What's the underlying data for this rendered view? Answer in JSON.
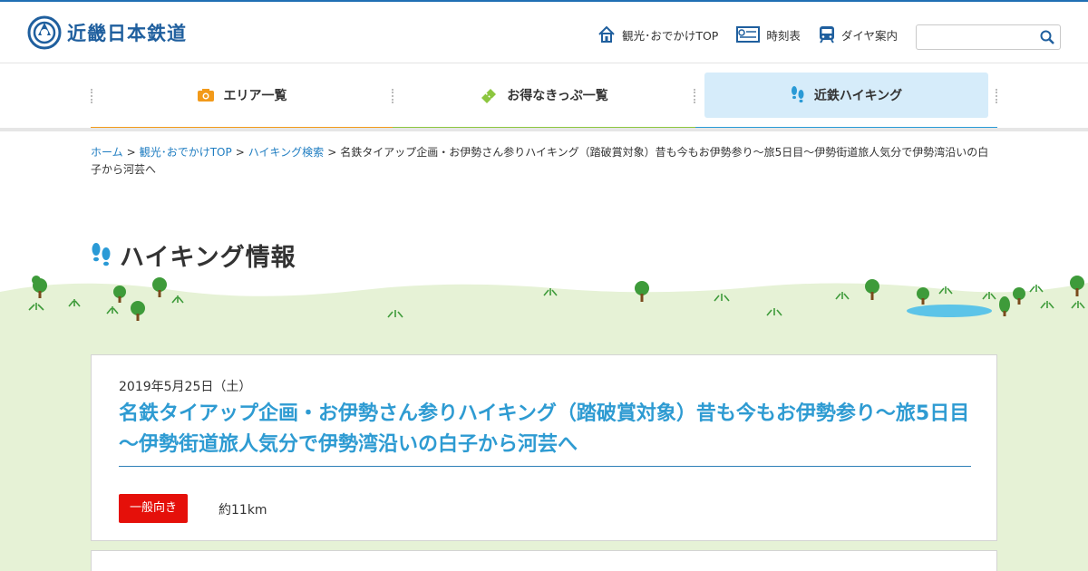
{
  "header": {
    "logo_text": "近畿日本鉄道",
    "links": [
      {
        "label": "観光･おでかけTOP",
        "icon": "house-icon"
      },
      {
        "label": "時刻表",
        "icon": "timetable-icon"
      },
      {
        "label": "ダイヤ案内",
        "icon": "train-icon"
      }
    ],
    "search": {
      "placeholder": "",
      "value": "",
      "icon": "search-icon"
    }
  },
  "nav": {
    "items": [
      {
        "label": "エリア一覧",
        "icon": "camera-icon",
        "color": "#f29a1a"
      },
      {
        "label": "お得なきっぷ一覧",
        "icon": "ticket-icon",
        "color": "#8cc63f"
      },
      {
        "label": "近鉄ハイキング",
        "icon": "footprints-icon",
        "color": "#2a9ad6",
        "active": true
      }
    ]
  },
  "breadcrumb": {
    "links": [
      "ホーム",
      "観光･おでかけTOP",
      "ハイキング検索"
    ],
    "separator": ">",
    "current": "名鉄タイアップ企画・お伊勢さん参りハイキング（踏破賞対象）昔も今もお伊勢参り～旅5日目～伊勢街道旅人気分で伊勢湾沿いの白子から河芸へ"
  },
  "page_title": "ハイキング情報",
  "event": {
    "date": "2019年5月25日（土）",
    "title": "名鉄タイアップ企画・お伊勢さん参りハイキング（踏破賞対象）昔も今もお伊勢参り～旅5日目～伊勢街道旅人気分で伊勢湾沿いの白子から河芸へ",
    "level": "一般向き",
    "level_color": "#e5100a",
    "distance": "約11km"
  },
  "colors": {
    "brand": "#1f5f9e",
    "link": "#1f7dc1",
    "title": "#2e9bd2",
    "grass": "#e8f3da"
  }
}
